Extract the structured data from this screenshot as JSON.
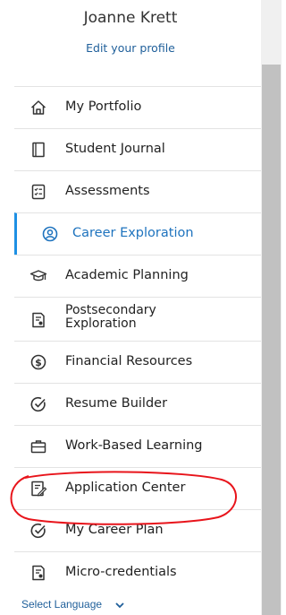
{
  "profile": {
    "name": "Joanne Krett",
    "edit_link": "Edit your profile"
  },
  "nav": {
    "items": [
      {
        "label": "My Portfolio",
        "icon": "home-icon"
      },
      {
        "label": "Student Journal",
        "icon": "journal-icon"
      },
      {
        "label": "Assessments",
        "icon": "checklist-icon"
      },
      {
        "label": "Career Exploration",
        "icon": "person-circle-icon",
        "active": true
      },
      {
        "label": "Academic Planning",
        "icon": "graduation-cap-icon"
      },
      {
        "label_line1": "Postsecondary",
        "label_line2": "Exploration",
        "icon": "document-pin-icon"
      },
      {
        "label": "Financial Resources",
        "icon": "dollar-circle-icon"
      },
      {
        "label": "Resume Builder",
        "icon": "check-circle-icon"
      },
      {
        "label": "Work-Based Learning",
        "icon": "briefcase-icon"
      },
      {
        "label": "Application Center",
        "icon": "application-form-icon",
        "annotated": true
      },
      {
        "label": "My Career Plan",
        "icon": "check-circle-icon"
      },
      {
        "label": "Micro-credentials",
        "icon": "document-pin-icon"
      }
    ]
  },
  "language": {
    "label": "Select Language"
  },
  "colors": {
    "active_accent": "#1e90e4",
    "active_text": "#1e73be",
    "link": "#1f5f9a",
    "annotation": "#e8141b",
    "scroll_thumb": "#c1c1c1"
  }
}
